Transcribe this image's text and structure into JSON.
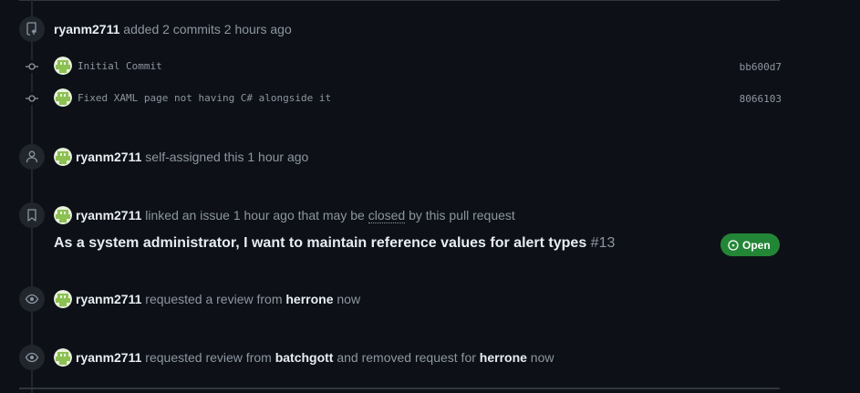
{
  "events": {
    "commits_added": {
      "user": "ryanm2711",
      "action": "added 2 commits",
      "time": "2 hours ago"
    },
    "commits": [
      {
        "message": "Initial Commit",
        "sha": "bb600d7"
      },
      {
        "message": "Fixed XAML page not having C# alongside it",
        "sha": "8066103"
      }
    ],
    "self_assigned": {
      "user": "ryanm2711",
      "action": "self-assigned this",
      "time": "1 hour ago"
    },
    "linked_issue": {
      "user": "ryanm2711",
      "action_before": "linked an issue",
      "time": "1 hour ago",
      "action_mid": "that may be",
      "closed_word": "closed",
      "action_after": "by this pull request",
      "issue_title": "As a system administrator, I want to maintain reference values for alert types",
      "issue_number": "#13",
      "issue_status": "Open"
    },
    "review_request": {
      "user": "ryanm2711",
      "action": "requested a review from",
      "reviewer": "herrone",
      "time": "now"
    },
    "review_change": {
      "user": "ryanm2711",
      "action_before": "requested review from",
      "added_reviewer": "batchgott",
      "action_mid": "and removed request for",
      "removed_reviewer": "herrone",
      "time": "now"
    }
  },
  "icons": {
    "commits_badge": "repo-push-icon",
    "commit_node": "git-commit-icon",
    "assign_badge": "person-icon",
    "link_badge": "bookmark-icon",
    "review_badge": "eye-icon",
    "status": "issue-opened-icon"
  },
  "colors": {
    "background": "#0d1117",
    "text": "#e6edf3",
    "muted": "#8d96a0",
    "open_green": "#238636",
    "badge_bg": "#21262d"
  }
}
